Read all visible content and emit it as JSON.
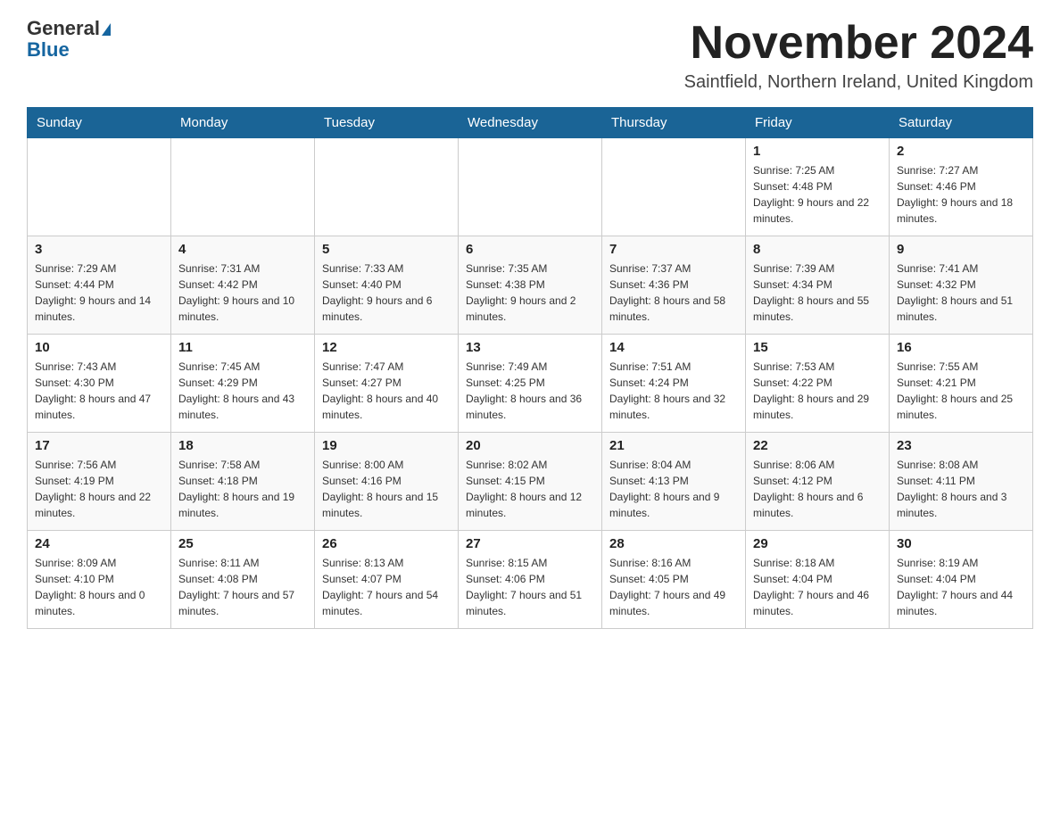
{
  "header": {
    "logo_general": "General",
    "logo_blue": "Blue",
    "month_title": "November 2024",
    "location": "Saintfield, Northern Ireland, United Kingdom"
  },
  "days_of_week": [
    "Sunday",
    "Monday",
    "Tuesday",
    "Wednesday",
    "Thursday",
    "Friday",
    "Saturday"
  ],
  "weeks": [
    [
      {
        "day": "",
        "info": ""
      },
      {
        "day": "",
        "info": ""
      },
      {
        "day": "",
        "info": ""
      },
      {
        "day": "",
        "info": ""
      },
      {
        "day": "",
        "info": ""
      },
      {
        "day": "1",
        "info": "Sunrise: 7:25 AM\nSunset: 4:48 PM\nDaylight: 9 hours and 22 minutes."
      },
      {
        "day": "2",
        "info": "Sunrise: 7:27 AM\nSunset: 4:46 PM\nDaylight: 9 hours and 18 minutes."
      }
    ],
    [
      {
        "day": "3",
        "info": "Sunrise: 7:29 AM\nSunset: 4:44 PM\nDaylight: 9 hours and 14 minutes."
      },
      {
        "day": "4",
        "info": "Sunrise: 7:31 AM\nSunset: 4:42 PM\nDaylight: 9 hours and 10 minutes."
      },
      {
        "day": "5",
        "info": "Sunrise: 7:33 AM\nSunset: 4:40 PM\nDaylight: 9 hours and 6 minutes."
      },
      {
        "day": "6",
        "info": "Sunrise: 7:35 AM\nSunset: 4:38 PM\nDaylight: 9 hours and 2 minutes."
      },
      {
        "day": "7",
        "info": "Sunrise: 7:37 AM\nSunset: 4:36 PM\nDaylight: 8 hours and 58 minutes."
      },
      {
        "day": "8",
        "info": "Sunrise: 7:39 AM\nSunset: 4:34 PM\nDaylight: 8 hours and 55 minutes."
      },
      {
        "day": "9",
        "info": "Sunrise: 7:41 AM\nSunset: 4:32 PM\nDaylight: 8 hours and 51 minutes."
      }
    ],
    [
      {
        "day": "10",
        "info": "Sunrise: 7:43 AM\nSunset: 4:30 PM\nDaylight: 8 hours and 47 minutes."
      },
      {
        "day": "11",
        "info": "Sunrise: 7:45 AM\nSunset: 4:29 PM\nDaylight: 8 hours and 43 minutes."
      },
      {
        "day": "12",
        "info": "Sunrise: 7:47 AM\nSunset: 4:27 PM\nDaylight: 8 hours and 40 minutes."
      },
      {
        "day": "13",
        "info": "Sunrise: 7:49 AM\nSunset: 4:25 PM\nDaylight: 8 hours and 36 minutes."
      },
      {
        "day": "14",
        "info": "Sunrise: 7:51 AM\nSunset: 4:24 PM\nDaylight: 8 hours and 32 minutes."
      },
      {
        "day": "15",
        "info": "Sunrise: 7:53 AM\nSunset: 4:22 PM\nDaylight: 8 hours and 29 minutes."
      },
      {
        "day": "16",
        "info": "Sunrise: 7:55 AM\nSunset: 4:21 PM\nDaylight: 8 hours and 25 minutes."
      }
    ],
    [
      {
        "day": "17",
        "info": "Sunrise: 7:56 AM\nSunset: 4:19 PM\nDaylight: 8 hours and 22 minutes."
      },
      {
        "day": "18",
        "info": "Sunrise: 7:58 AM\nSunset: 4:18 PM\nDaylight: 8 hours and 19 minutes."
      },
      {
        "day": "19",
        "info": "Sunrise: 8:00 AM\nSunset: 4:16 PM\nDaylight: 8 hours and 15 minutes."
      },
      {
        "day": "20",
        "info": "Sunrise: 8:02 AM\nSunset: 4:15 PM\nDaylight: 8 hours and 12 minutes."
      },
      {
        "day": "21",
        "info": "Sunrise: 8:04 AM\nSunset: 4:13 PM\nDaylight: 8 hours and 9 minutes."
      },
      {
        "day": "22",
        "info": "Sunrise: 8:06 AM\nSunset: 4:12 PM\nDaylight: 8 hours and 6 minutes."
      },
      {
        "day": "23",
        "info": "Sunrise: 8:08 AM\nSunset: 4:11 PM\nDaylight: 8 hours and 3 minutes."
      }
    ],
    [
      {
        "day": "24",
        "info": "Sunrise: 8:09 AM\nSunset: 4:10 PM\nDaylight: 8 hours and 0 minutes."
      },
      {
        "day": "25",
        "info": "Sunrise: 8:11 AM\nSunset: 4:08 PM\nDaylight: 7 hours and 57 minutes."
      },
      {
        "day": "26",
        "info": "Sunrise: 8:13 AM\nSunset: 4:07 PM\nDaylight: 7 hours and 54 minutes."
      },
      {
        "day": "27",
        "info": "Sunrise: 8:15 AM\nSunset: 4:06 PM\nDaylight: 7 hours and 51 minutes."
      },
      {
        "day": "28",
        "info": "Sunrise: 8:16 AM\nSunset: 4:05 PM\nDaylight: 7 hours and 49 minutes."
      },
      {
        "day": "29",
        "info": "Sunrise: 8:18 AM\nSunset: 4:04 PM\nDaylight: 7 hours and 46 minutes."
      },
      {
        "day": "30",
        "info": "Sunrise: 8:19 AM\nSunset: 4:04 PM\nDaylight: 7 hours and 44 minutes."
      }
    ]
  ]
}
